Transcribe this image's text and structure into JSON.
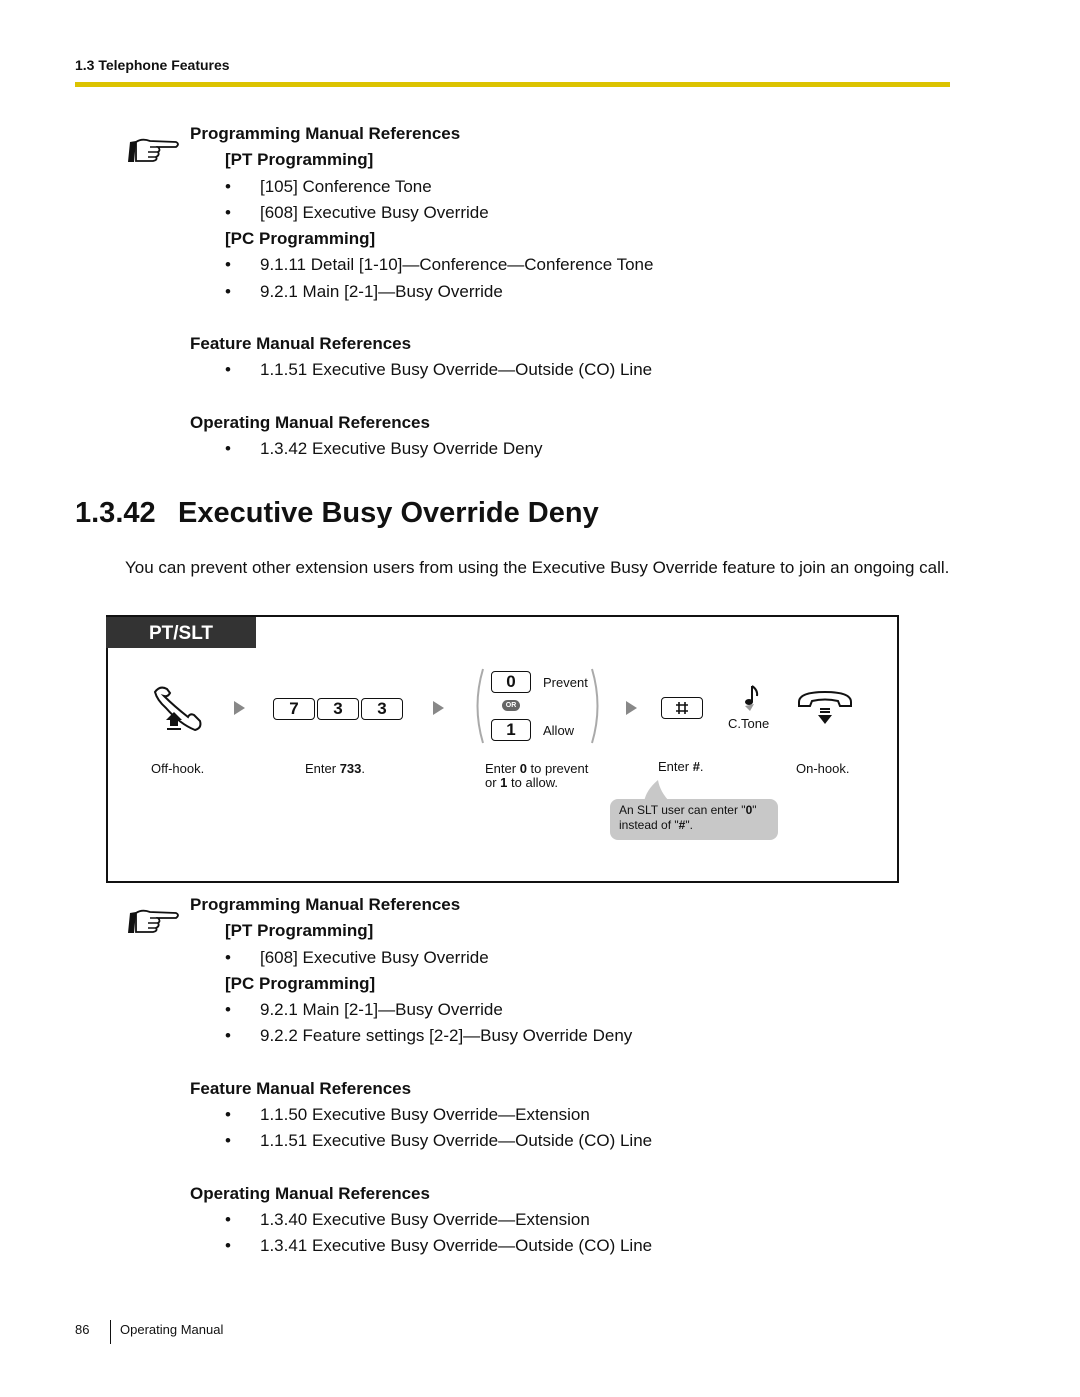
{
  "running_head": "1.3 Telephone Features",
  "top_refs": {
    "programming_heading": "Programming Manual References",
    "pt_heading": "[PT Programming]",
    "pt_items": [
      "[105] Conference Tone",
      "[608] Executive Busy Override"
    ],
    "pc_heading": "[PC Programming]",
    "pc_items": [
      "9.1.11 Detail [1-10]—Conference—Conference Tone",
      "9.2.1 Main [2-1]—Busy Override"
    ],
    "feature_heading": "Feature Manual References",
    "feature_items": [
      "1.1.51 Executive Busy Override—Outside (CO) Line"
    ],
    "operating_heading": "Operating Manual References",
    "operating_items": [
      "1.3.42 Executive Busy Override Deny"
    ]
  },
  "section": {
    "number": "1.3.42",
    "title": "Executive Busy Override Deny",
    "intro": "You can prevent other extension users from using the Executive Busy Override feature to join an ongoing call."
  },
  "procedure": {
    "tab_label": "PT/SLT",
    "keys_733": [
      "7",
      "3",
      "3"
    ],
    "key_0": "0",
    "key_1": "1",
    "option_prevent": "Prevent",
    "option_or": "OR",
    "option_allow": "Allow",
    "key_hash": "#",
    "ctone_label": "C.Tone",
    "captions": {
      "offhook": "Off-hook.",
      "enter733_pre": "Enter ",
      "enter733_code": "733",
      "enter733_post": ".",
      "choice_pre": "Enter ",
      "choice_0": "0",
      "choice_mid": " to prevent",
      "choice_or": "or ",
      "choice_1": "1",
      "choice_post": " to allow.",
      "hash_pre": "Enter ",
      "hash_code": "#",
      "hash_post": ".",
      "onhook": "On-hook."
    },
    "bubble": {
      "line1_pre": "An SLT user can enter \"",
      "line1_code": "0",
      "line1_post": "\"",
      "line2_pre": "instead of \"",
      "line2_code": "#",
      "line2_post": "\"."
    }
  },
  "bottom_refs": {
    "programming_heading": "Programming Manual References",
    "pt_heading": "[PT Programming]",
    "pt_items": [
      "[608] Executive Busy Override"
    ],
    "pc_heading": "[PC Programming]",
    "pc_items": [
      "9.2.1 Main [2-1]—Busy Override",
      "9.2.2 Feature settings [2-2]—Busy Override Deny"
    ],
    "feature_heading": "Feature Manual References",
    "feature_items": [
      "1.1.50 Executive Busy Override—Extension",
      "1.1.51 Executive Busy Override—Outside (CO) Line"
    ],
    "operating_heading": "Operating Manual References",
    "operating_items": [
      "1.3.40 Executive Busy Override—Extension",
      "1.3.41 Executive Busy Override—Outside (CO) Line"
    ]
  },
  "footer": {
    "page_number": "86",
    "label": "Operating Manual"
  },
  "colors": {
    "rule": "#dcc300",
    "tab_bg": "#333333",
    "bubble_bg": "#c8c8c8"
  }
}
